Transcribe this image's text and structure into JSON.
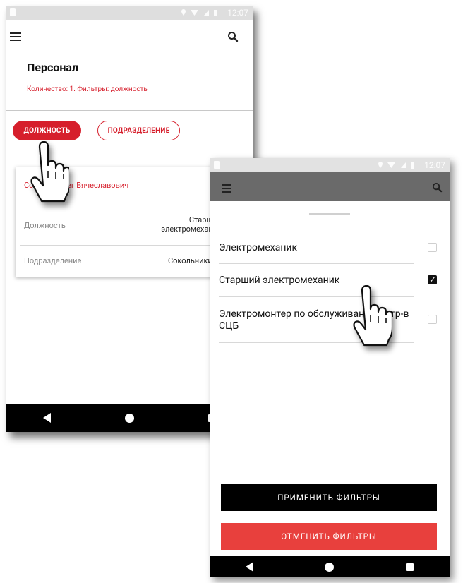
{
  "colors": {
    "accent": "#d61f2c",
    "status_bar_light": "#dedede",
    "status_bar_dark": "#e2e2e2",
    "appbar_dark": "#6a6a6a",
    "apply": "#000000",
    "cancel": "#e8403d"
  },
  "status": {
    "time": "12:07"
  },
  "screen1": {
    "title": "Персонал",
    "subtitle": "Количество: 1. Фильтры: должность",
    "filter_position": "ДОЛЖНОСТЬ",
    "filter_department": "ПОДРАЗДЕЛЕНИЕ",
    "card": {
      "name": "Соколов Олег Вячеславович",
      "rows": [
        {
          "label": "Должность",
          "value": "Старший электромеханик"
        },
        {
          "label": "Подразделение",
          "value": "Сокольники"
        }
      ]
    }
  },
  "screen2": {
    "options": [
      {
        "label": "Электромеханик",
        "checked": false
      },
      {
        "label": "Старший электромеханик",
        "checked": true
      },
      {
        "label": "Электромонтер по обслуживанию устр-в СЦБ",
        "checked": false
      }
    ],
    "apply_button": "ПРИМЕНИТЬ ФИЛЬТРЫ",
    "cancel_button": "ОТМЕНИТЬ ФИЛЬТРЫ"
  },
  "icons": {
    "menu": "hamburger-icon",
    "search": "search-icon",
    "cursor": "hand-pointer-icon",
    "back": "nav-back-icon",
    "home": "nav-home-icon",
    "recents": "nav-recents-icon"
  }
}
